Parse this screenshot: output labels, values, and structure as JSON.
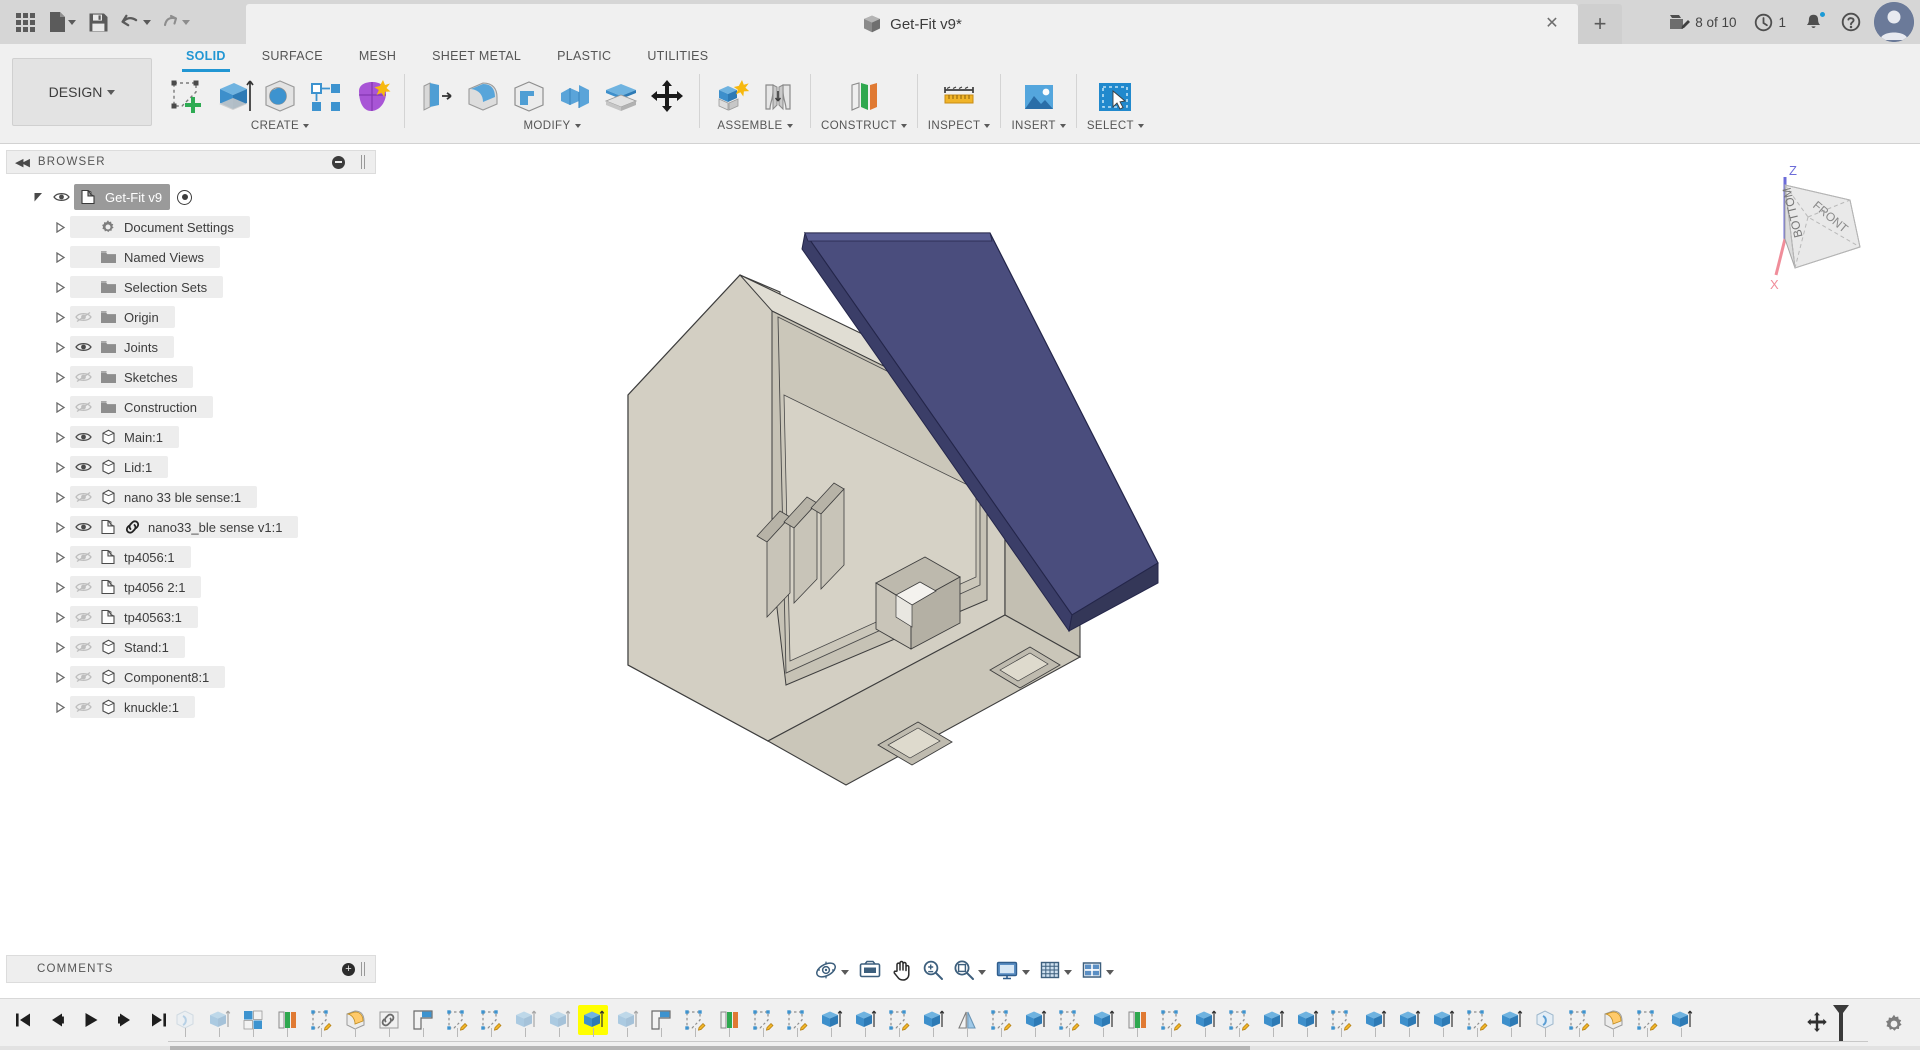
{
  "app": {
    "title": "Get-Fit v9*",
    "accent_blue": "#2196d3",
    "canvas_bg": "#ffffff"
  },
  "quick_access": {
    "items": [
      {
        "name": "app-grid",
        "label": "Show Data Panel",
        "icon": "grid-icon"
      },
      {
        "name": "file",
        "label": "File",
        "icon": "file-icon",
        "has_menu": true
      },
      {
        "name": "save",
        "label": "Save",
        "icon": "save-icon"
      },
      {
        "name": "undo",
        "label": "Undo",
        "icon": "undo-icon",
        "has_menu": true
      },
      {
        "name": "redo",
        "label": "Redo",
        "icon": "redo-icon",
        "has_menu": true
      }
    ]
  },
  "status_right": {
    "job_status": "8 of 10",
    "job_icon": "upload-job-icon",
    "history_count": "1",
    "history_icon": "clock-icon",
    "notifications_icon": "bell-icon",
    "notifications_has_dot": true,
    "help_icon": "help-icon",
    "avatar_icon": "user-avatar",
    "close_tab_icon": "close-icon",
    "add_tab_icon": "plus-icon"
  },
  "workspace": {
    "label": "DESIGN",
    "has_menu": true
  },
  "ribbon": {
    "tabs": [
      {
        "label": "SOLID",
        "active": true
      },
      {
        "label": "SURFACE",
        "active": false
      },
      {
        "label": "MESH",
        "active": false
      },
      {
        "label": "SHEET METAL",
        "active": false
      },
      {
        "label": "PLASTIC",
        "active": false
      },
      {
        "label": "UTILITIES",
        "active": false
      }
    ],
    "groups": [
      {
        "label": "CREATE",
        "has_menu": true,
        "tools": [
          {
            "name": "create-sketch-tool",
            "icon": "create-sketch-icon"
          },
          {
            "name": "extrude-tool",
            "icon": "extrude-icon"
          },
          {
            "name": "revolve-tool",
            "icon": "revolve-icon"
          },
          {
            "name": "pattern-tool",
            "icon": "rectangular-pattern-icon"
          },
          {
            "name": "form-tool",
            "icon": "create-form-icon"
          }
        ]
      },
      {
        "label": "MODIFY",
        "has_menu": true,
        "tools": [
          {
            "name": "press-pull-tool",
            "icon": "press-pull-icon"
          },
          {
            "name": "fillet-tool",
            "icon": "fillet-icon"
          },
          {
            "name": "shell-tool",
            "icon": "shell-icon"
          },
          {
            "name": "combine-tool",
            "icon": "combine-icon"
          },
          {
            "name": "split-face-tool",
            "icon": "split-face-icon"
          },
          {
            "name": "move-copy-tool",
            "icon": "move-copy-icon"
          }
        ]
      },
      {
        "label": "ASSEMBLE",
        "has_menu": true,
        "tools": [
          {
            "name": "new-component-tool",
            "icon": "new-component-icon"
          },
          {
            "name": "joint-tool",
            "icon": "joint-icon"
          }
        ]
      },
      {
        "label": "CONSTRUCT",
        "has_menu": true,
        "tools": [
          {
            "name": "offset-plane-tool",
            "icon": "offset-plane-icon"
          }
        ]
      },
      {
        "label": "INSPECT",
        "has_menu": true,
        "tools": [
          {
            "name": "measure-tool",
            "icon": "measure-icon"
          }
        ]
      },
      {
        "label": "INSERT",
        "has_menu": true,
        "tools": [
          {
            "name": "insert-mcmaster-tool",
            "icon": "insert-image-icon"
          }
        ]
      },
      {
        "label": "SELECT",
        "has_menu": true,
        "tools": [
          {
            "name": "select-tool",
            "icon": "select-window-icon"
          }
        ]
      }
    ]
  },
  "browser": {
    "panel_title": "BROWSER",
    "collapse_icon": "collapse-left-icon",
    "minimize_icon": "minus-circle-icon",
    "root": {
      "label": "Get-Fit v9",
      "selected": true,
      "visible": true,
      "icon": "document-component-icon",
      "activate_icon": "radio-dot-icon"
    },
    "items": [
      {
        "label": "Document Settings",
        "icon": "gear-icon",
        "eye": "none",
        "indent": 1
      },
      {
        "label": "Named Views",
        "icon": "folder-icon",
        "eye": "none",
        "indent": 1
      },
      {
        "label": "Selection Sets",
        "icon": "folder-icon",
        "eye": "none",
        "indent": 1
      },
      {
        "label": "Origin",
        "icon": "folder-icon",
        "eye": "hidden",
        "indent": 1
      },
      {
        "label": "Joints",
        "icon": "folder-icon",
        "eye": "visible",
        "indent": 1
      },
      {
        "label": "Sketches",
        "icon": "folder-icon",
        "eye": "hidden",
        "indent": 1
      },
      {
        "label": "Construction",
        "icon": "folder-icon",
        "eye": "hidden",
        "indent": 1
      },
      {
        "label": "Main:1",
        "icon": "body-icon",
        "eye": "visible",
        "indent": 1
      },
      {
        "label": "Lid:1",
        "icon": "body-icon",
        "eye": "visible",
        "indent": 1
      },
      {
        "label": "nano 33 ble sense:1",
        "icon": "body-icon",
        "eye": "hidden",
        "indent": 1
      },
      {
        "label": "nano33_ble sense v1:1",
        "icon": "component-icon",
        "eye": "visible",
        "indent": 1,
        "link_icon": "linked-icon"
      },
      {
        "label": "tp4056:1",
        "icon": "component-icon",
        "eye": "hidden",
        "indent": 1
      },
      {
        "label": "tp4056 2:1",
        "icon": "component-icon",
        "eye": "hidden",
        "indent": 1
      },
      {
        "label": "tp40563:1",
        "icon": "component-icon",
        "eye": "hidden",
        "indent": 1
      },
      {
        "label": "Stand:1",
        "icon": "body-icon",
        "eye": "hidden",
        "indent": 1
      },
      {
        "label": "Component8:1",
        "icon": "body-icon",
        "eye": "hidden",
        "indent": 1
      },
      {
        "label": "knuckle:1",
        "icon": "body-icon",
        "eye": "hidden",
        "indent": 1
      }
    ]
  },
  "comments": {
    "panel_title": "COMMENTS",
    "add_icon": "plus-circle-icon"
  },
  "viewcube": {
    "face_front": "FRONT",
    "face_bottom": "BOTTOM",
    "axis_z": "Z",
    "axis_x": "X",
    "axis_z_color": "#4a4ad0",
    "axis_x_color": "#e86a7a"
  },
  "model": {
    "body_color": "#d2cec2",
    "body_shadow": "#b9b5a8",
    "lid_color": "#4a4d7d",
    "lid_dark": "#383b63",
    "edge_color": "#4a4a4a",
    "parts": [
      "Main enclosure",
      "Lid"
    ]
  },
  "navbar": {
    "items": [
      {
        "name": "orbit-button",
        "icon": "orbit-icon",
        "has_menu": true
      },
      {
        "name": "look-at-button",
        "icon": "look-at-icon",
        "has_menu": false
      },
      {
        "name": "pan-button",
        "icon": "pan-hand-icon",
        "has_menu": false
      },
      {
        "name": "zoom-button",
        "icon": "zoom-icon",
        "has_menu": false
      },
      {
        "name": "fit-button",
        "icon": "zoom-fit-icon",
        "has_menu": true
      },
      {
        "name": "display-settings-button",
        "icon": "monitor-icon",
        "has_menu": true
      },
      {
        "name": "grid-snaps-button",
        "icon": "grid-icon",
        "has_menu": true
      },
      {
        "name": "viewports-button",
        "icon": "viewport-layout-icon",
        "has_menu": true
      }
    ]
  },
  "timeline": {
    "playback": [
      {
        "name": "go-to-beginning-button",
        "icon": "skip-start-icon"
      },
      {
        "name": "step-back-button",
        "icon": "step-back-icon"
      },
      {
        "name": "play-button",
        "icon": "play-icon"
      },
      {
        "name": "step-forward-button",
        "icon": "step-forward-icon"
      },
      {
        "name": "go-to-end-button",
        "icon": "skip-end-icon"
      }
    ],
    "settings_icon": "gear-icon",
    "marker_icon": "timeline-marker-icon",
    "move_icon": "move-icon",
    "features": [
      {
        "icon": "revolve-feature-icon",
        "selected": false,
        "dim": true
      },
      {
        "icon": "extrude-feature-icon",
        "selected": false,
        "dim": true
      },
      {
        "icon": "component-feature-icon",
        "selected": false,
        "dim": false
      },
      {
        "icon": "plane-feature-icon",
        "selected": false,
        "dim": false
      },
      {
        "icon": "sketch-feature-icon",
        "selected": false,
        "dim": false
      },
      {
        "icon": "fillet-feature-icon",
        "selected": false,
        "dim": false
      },
      {
        "icon": "linked-feature-icon",
        "selected": false,
        "dim": false
      },
      {
        "icon": "rib-feature-icon",
        "selected": false,
        "dim": false
      },
      {
        "icon": "sketch-feature-icon",
        "selected": false,
        "dim": false
      },
      {
        "icon": "sketch-feature-icon",
        "selected": false,
        "dim": false
      },
      {
        "icon": "extrude-feature-icon",
        "selected": false,
        "dim": true
      },
      {
        "icon": "extrude-feature-icon",
        "selected": false,
        "dim": true
      },
      {
        "icon": "extrude-feature-icon",
        "selected": true,
        "dim": false
      },
      {
        "icon": "extrude-feature-icon",
        "selected": false,
        "dim": true
      },
      {
        "icon": "rib-feature-icon",
        "selected": false,
        "dim": false
      },
      {
        "icon": "sketch-feature-icon",
        "selected": false,
        "dim": false
      },
      {
        "icon": "plane-feature-icon",
        "selected": false,
        "dim": false
      },
      {
        "icon": "sketch-feature-icon",
        "selected": false,
        "dim": false
      },
      {
        "icon": "sketch-feature-icon",
        "selected": false,
        "dim": false
      },
      {
        "icon": "extrude-feature-icon",
        "selected": false,
        "dim": false
      },
      {
        "icon": "extrude-feature-icon",
        "selected": false,
        "dim": false
      },
      {
        "icon": "sketch-feature-icon",
        "selected": false,
        "dim": false
      },
      {
        "icon": "extrude-feature-icon",
        "selected": false,
        "dim": false
      },
      {
        "icon": "mirror-feature-icon",
        "selected": false,
        "dim": false
      },
      {
        "icon": "sketch-feature-icon",
        "selected": false,
        "dim": false
      },
      {
        "icon": "extrude-feature-icon",
        "selected": false,
        "dim": false
      },
      {
        "icon": "sketch-feature-icon",
        "selected": false,
        "dim": false
      },
      {
        "icon": "extrude-feature-icon",
        "selected": false,
        "dim": false
      },
      {
        "icon": "plane-feature-icon",
        "selected": false,
        "dim": false
      },
      {
        "icon": "sketch-feature-icon",
        "selected": false,
        "dim": false
      },
      {
        "icon": "extrude-feature-icon",
        "selected": false,
        "dim": false
      },
      {
        "icon": "sketch-feature-icon",
        "selected": false,
        "dim": false
      },
      {
        "icon": "extrude-feature-icon",
        "selected": false,
        "dim": false
      },
      {
        "icon": "extrude-feature-icon",
        "selected": false,
        "dim": false
      },
      {
        "icon": "sketch-feature-icon",
        "selected": false,
        "dim": false
      },
      {
        "icon": "extrude-feature-icon",
        "selected": false,
        "dim": false
      },
      {
        "icon": "extrude-feature-icon",
        "selected": false,
        "dim": false
      },
      {
        "icon": "extrude-feature-icon",
        "selected": false,
        "dim": false
      },
      {
        "icon": "sketch-feature-icon",
        "selected": false,
        "dim": false
      },
      {
        "icon": "extrude-feature-icon",
        "selected": false,
        "dim": false
      },
      {
        "icon": "revolve-feature-icon",
        "selected": false,
        "dim": false
      },
      {
        "icon": "sketch-feature-icon",
        "selected": false,
        "dim": false
      },
      {
        "icon": "fillet-feature-icon",
        "selected": false,
        "dim": false
      },
      {
        "icon": "sketch-feature-icon",
        "selected": false,
        "dim": false
      },
      {
        "icon": "extrude-feature-icon",
        "selected": false,
        "dim": false
      }
    ]
  }
}
